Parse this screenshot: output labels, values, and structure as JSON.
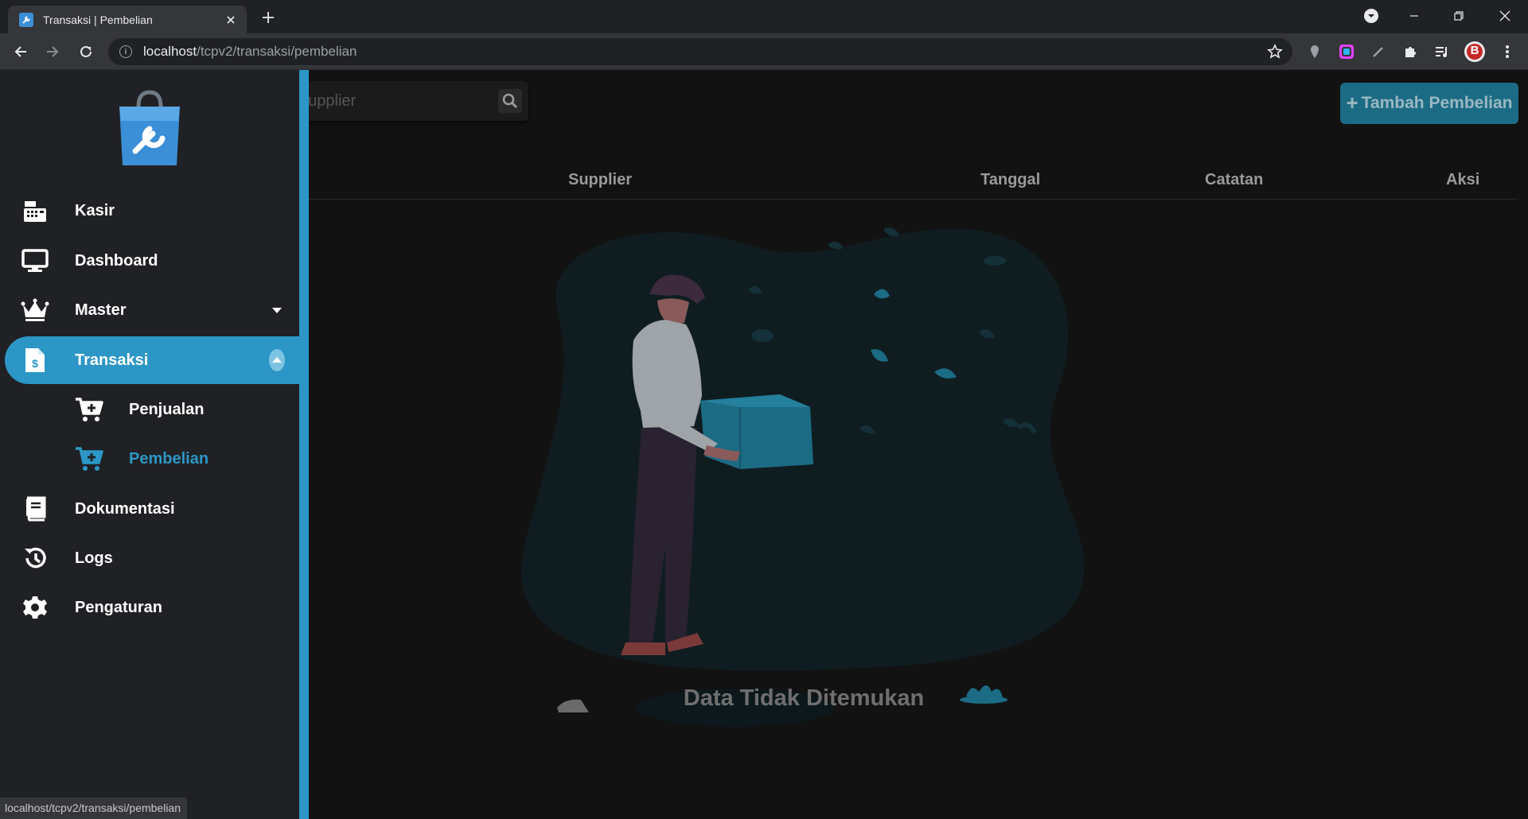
{
  "browser": {
    "tab_title": "Transaksi | Pembelian",
    "url_host": "localhost",
    "url_path": "/tcpv2/transaksi/pembelian",
    "status_url": "localhost/tcpv2/transaksi/pembelian",
    "profile_initial": "B"
  },
  "sidebar": {
    "items": [
      {
        "label": "Kasir",
        "icon": "cash-register-icon"
      },
      {
        "label": "Dashboard",
        "icon": "desktop-icon"
      },
      {
        "label": "Master",
        "icon": "crown-icon"
      },
      {
        "label": "Transaksi",
        "icon": "invoice-dollar-icon"
      },
      {
        "label": "Penjualan",
        "icon": "cart-plus-icon"
      },
      {
        "label": "Pembelian",
        "icon": "cart-plus-icon"
      },
      {
        "label": "Dokumentasi",
        "icon": "book-icon"
      },
      {
        "label": "Logs",
        "icon": "history-icon"
      },
      {
        "label": "Pengaturan",
        "icon": "gear-icon"
      }
    ]
  },
  "main": {
    "search_placeholder": "na Supplier",
    "add_button_label": "Tambah Pembelian",
    "columns": [
      "Supplier",
      "Tanggal",
      "Catatan",
      "Aksi"
    ],
    "empty_text": "Data Tidak Ditemukan"
  },
  "colors": {
    "accent": "#2c97c6",
    "sidebar_bg": "#202124",
    "page_bg": "#121212",
    "add_button_bg": "#1c6b84"
  }
}
